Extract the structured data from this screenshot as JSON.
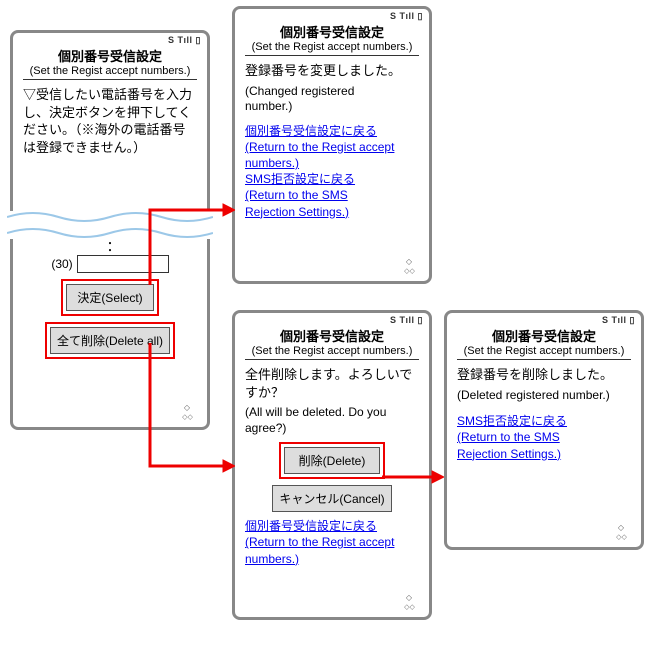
{
  "status_bar": "S Tıll ▯",
  "screen1": {
    "title_jp": "個別番号受信設定",
    "title_en": "(Set the Regist accept numbers.)",
    "instr_jp": "▽受信したい電話番号を入力し、決定ボタンを押下してください。（※海外の電話番号は登録できません。）",
    "row_label": "(30)",
    "btn_select": "決定(Select)",
    "btn_delete_all": "全て削除(Delete all)"
  },
  "screen2": {
    "title_jp": "個別番号受信設定",
    "title_en": "(Set the Regist accept numbers.)",
    "msg_jp": "登録番号を変更しました。",
    "msg_en1": "(Changed registered",
    "msg_en2": "number.)",
    "link1_jp": "個別番号受信設定に戻る",
    "link1_en1": "(Return to the Regist accept",
    "link1_en2": "numbers.)",
    "link2_jp": "SMS拒否設定に戻る",
    "link2_en1": "(Return to the SMS",
    "link2_en2": "Rejection Settings.)"
  },
  "screen3": {
    "title_jp": "個別番号受信設定",
    "title_en": "(Set the Regist accept numbers.)",
    "msg_jp": "全件削除します。よろしいですか？",
    "msg_en1": "(All will be deleted. Do you",
    "msg_en2": "agree?)",
    "btn_delete": "削除(Delete)",
    "btn_cancel": "キャンセル(Cancel)",
    "link1_jp": "個別番号受信設定に戻る",
    "link1_en1": "(Return to the Regist accept",
    "link1_en2": "numbers.)"
  },
  "screen4": {
    "title_jp": "個別番号受信設定",
    "title_en": "(Set the Regist accept numbers.)",
    "msg_jp": "登録番号を削除しました。",
    "msg_en": "(Deleted registered number.)",
    "link2_jp": "SMS拒否設定に戻る",
    "link2_en1": "(Return to the SMS",
    "link2_en2": "Rejection Settings.)"
  }
}
